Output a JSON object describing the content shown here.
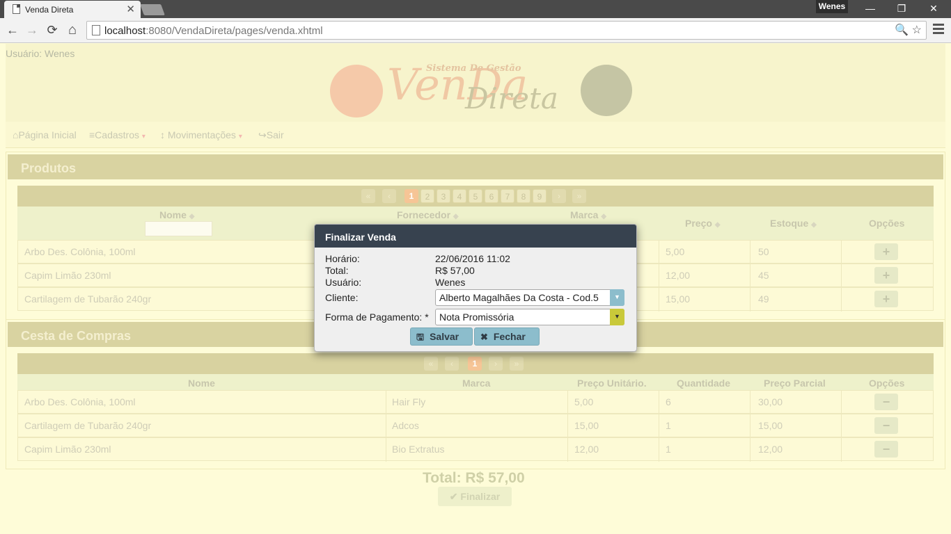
{
  "browser": {
    "tab_title": "Venda Direta",
    "tab_close": "✕",
    "user": "Wenes",
    "url_host": "localhost",
    "url_path": ":8080/VendaDireta/pages/venda.xhtml",
    "nav": {
      "back": "←",
      "forward": "→",
      "reload": "⟳",
      "home": "⌂"
    },
    "omni_icons": "🔍 ☆",
    "window_controls": {
      "minimize": "—",
      "restore": "❐",
      "close": "✕"
    }
  },
  "page": {
    "usuario": "Usuário: Wenes",
    "logo": {
      "subtitle": "Sistema De Gestão",
      "big_letters": "VenDa",
      "word": "Direta"
    },
    "menu": [
      {
        "label": "Página Inicial",
        "icon": "home-icon",
        "glyph": "⌂"
      },
      {
        "label": "Cadastros",
        "icon": "database-icon",
        "glyph": "≡"
      },
      {
        "label": "Movimentações",
        "icon": "arrows-icon",
        "glyph": "↕"
      },
      {
        "label": "Sair",
        "icon": "sign-out-icon",
        "glyph": "↪"
      }
    ],
    "caret": "▾"
  },
  "produtos": {
    "title": "Produtos",
    "paginator": {
      "first": "«",
      "prev": "‹",
      "pages": [
        "1",
        "2",
        "3",
        "4",
        "5",
        "6",
        "7",
        "8",
        "9"
      ],
      "next": "›",
      "last": "»"
    },
    "sort_icon": "◆",
    "columns": [
      "Nome",
      "Fornecedor",
      "Marca",
      "Preço",
      "Estoque",
      "Opções"
    ],
    "rows": [
      {
        "nome": "Arbo Des. Colônia, 100ml",
        "preco": "5,00",
        "estoque": "50",
        "btn": "+"
      },
      {
        "nome": "Capim Limão 230ml",
        "preco": "12,00",
        "estoque": "45",
        "btn": "+"
      },
      {
        "nome": "Cartilagem de Tubarão 240gr",
        "preco": "15,00",
        "estoque": "49",
        "btn": "+"
      }
    ]
  },
  "cesta": {
    "title": "Cesta de Compras",
    "paginator": {
      "first": "«",
      "prev": "‹",
      "pages": [
        "1"
      ],
      "next": "›",
      "last": "»"
    },
    "columns": [
      "Nome",
      "Marca",
      "Preço Unitário.",
      "Quantidade",
      "Preço Parcial",
      "Opções"
    ],
    "rows": [
      {
        "nome": "Arbo Des. Colônia, 100ml",
        "marca": "Hair Fly",
        "unit": "5,00",
        "qtd": "6",
        "parcial": "30,00",
        "btn": "−"
      },
      {
        "nome": "Cartilagem de Tubarão 240gr",
        "marca": "Adcos",
        "unit": "15,00",
        "qtd": "1",
        "parcial": "15,00",
        "btn": "−"
      },
      {
        "nome": "Capim Limão 230ml",
        "marca": "Bio Extratus",
        "unit": "12,00",
        "qtd": "1",
        "parcial": "12,00",
        "btn": "−"
      }
    ],
    "total": "Total: R$ 57,00",
    "finalizar": "Finalizar",
    "finalizar_icon": "✔"
  },
  "modal": {
    "title": "Finalizar Venda",
    "horario_label": "Horário:",
    "horario": "22/06/2016 11:02",
    "total_label": "Total:",
    "total": "R$ 57,00",
    "usuario_label": "Usuário:",
    "usuario": "Wenes",
    "cliente_label": "Cliente:",
    "cliente": "Alberto Magalhães Da Costa - Cod.5",
    "pagamento_label": "Forma de Pagamento:",
    "required_mark": "*",
    "pagamento": "Nota Promissória",
    "dropdown_arrow": "▼",
    "salvar": "Salvar",
    "salvar_icon": "🖫",
    "fechar": "Fechar",
    "fechar_icon": "✖",
    "colors": {
      "header": "#37424f",
      "cliente_arrow": "#8cbdcc",
      "pagamento_arrow": "#c9c93a"
    }
  }
}
